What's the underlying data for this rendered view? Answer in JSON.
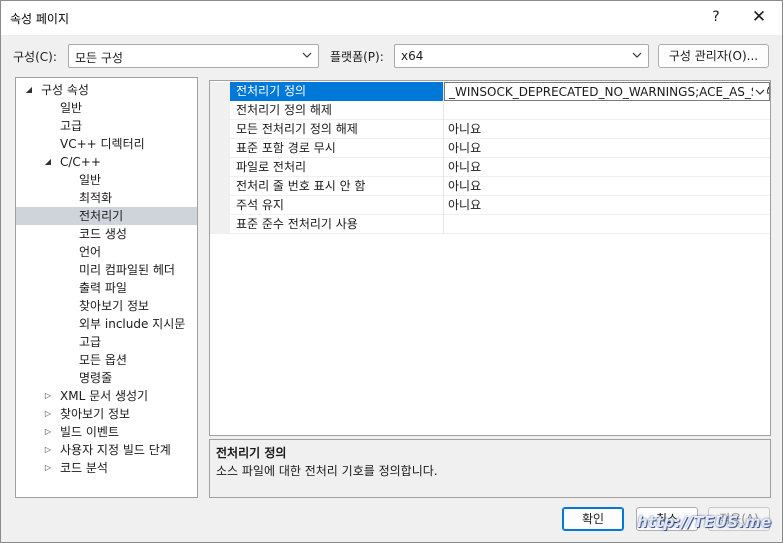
{
  "window": {
    "title": "속성 페이지",
    "help_glyph": "?",
    "close_glyph": "✕"
  },
  "config": {
    "configuration_label": "구성(C):",
    "configuration_value": "모든 구성",
    "platform_label": "플랫폼(P):",
    "platform_value": "x64",
    "manager_button": "구성 관리자(O)..."
  },
  "tree": {
    "items": [
      {
        "label": "구성 속성",
        "level": 0,
        "arrow": "◢",
        "selected": false
      },
      {
        "label": "일반",
        "level": 1,
        "arrow": "",
        "selected": false
      },
      {
        "label": "고급",
        "level": 1,
        "arrow": "",
        "selected": false
      },
      {
        "label": "VC++ 디렉터리",
        "level": 1,
        "arrow": "",
        "selected": false
      },
      {
        "label": "C/C++",
        "level": 1,
        "arrow": "◢",
        "selected": false
      },
      {
        "label": "일반",
        "level": 2,
        "arrow": "",
        "selected": false
      },
      {
        "label": "최적화",
        "level": 2,
        "arrow": "",
        "selected": false
      },
      {
        "label": "전처리기",
        "level": 2,
        "arrow": "",
        "selected": true
      },
      {
        "label": "코드 생성",
        "level": 2,
        "arrow": "",
        "selected": false
      },
      {
        "label": "언어",
        "level": 2,
        "arrow": "",
        "selected": false
      },
      {
        "label": "미리 컴파일된 헤더",
        "level": 2,
        "arrow": "",
        "selected": false
      },
      {
        "label": "출력 파일",
        "level": 2,
        "arrow": "",
        "selected": false
      },
      {
        "label": "찾아보기 정보",
        "level": 2,
        "arrow": "",
        "selected": false
      },
      {
        "label": "외부 include 지시문",
        "level": 2,
        "arrow": "",
        "selected": false
      },
      {
        "label": "고급",
        "level": 2,
        "arrow": "",
        "selected": false
      },
      {
        "label": "모든 옵션",
        "level": 2,
        "arrow": "",
        "selected": false
      },
      {
        "label": "명령줄",
        "level": 2,
        "arrow": "",
        "selected": false
      },
      {
        "label": "XML 문서 생성기",
        "level": 1,
        "arrow": "▷",
        "selected": false
      },
      {
        "label": "찾아보기 정보",
        "level": 1,
        "arrow": "▷",
        "selected": false
      },
      {
        "label": "빌드 이벤트",
        "level": 1,
        "arrow": "▷",
        "selected": false
      },
      {
        "label": "사용자 지정 빌드 단계",
        "level": 1,
        "arrow": "▷",
        "selected": false
      },
      {
        "label": "코드 분석",
        "level": 1,
        "arrow": "▷",
        "selected": false
      }
    ]
  },
  "grid": {
    "rows": [
      {
        "name": "전처리기 정의",
        "value": "_WINSOCK_DEPRECATED_NO_WARNINGS;ACE_AS_STA",
        "selected": true
      },
      {
        "name": "전처리기 정의 해제",
        "value": "",
        "selected": false
      },
      {
        "name": "모든 전처리기 정의 해제",
        "value": "아니요",
        "selected": false
      },
      {
        "name": "표준 포함 경로 무시",
        "value": "아니요",
        "selected": false
      },
      {
        "name": "파일로 전처리",
        "value": "아니요",
        "selected": false
      },
      {
        "name": "전처리 줄 번호 표시 안 함",
        "value": "아니요",
        "selected": false
      },
      {
        "name": "주석 유지",
        "value": "아니요",
        "selected": false
      },
      {
        "name": "표준 준수 전처리기 사용",
        "value": "",
        "selected": false
      }
    ]
  },
  "description": {
    "title": "전처리기 정의",
    "text": "소스 파일에 대한 전처리 기호를 정의합니다."
  },
  "footer": {
    "ok": "확인",
    "cancel": "취소",
    "apply": "적용(A)"
  },
  "watermark": "http://TEUS.me",
  "colors": {
    "accent": "#0078d7",
    "tree_selected": "#cfd4db"
  }
}
